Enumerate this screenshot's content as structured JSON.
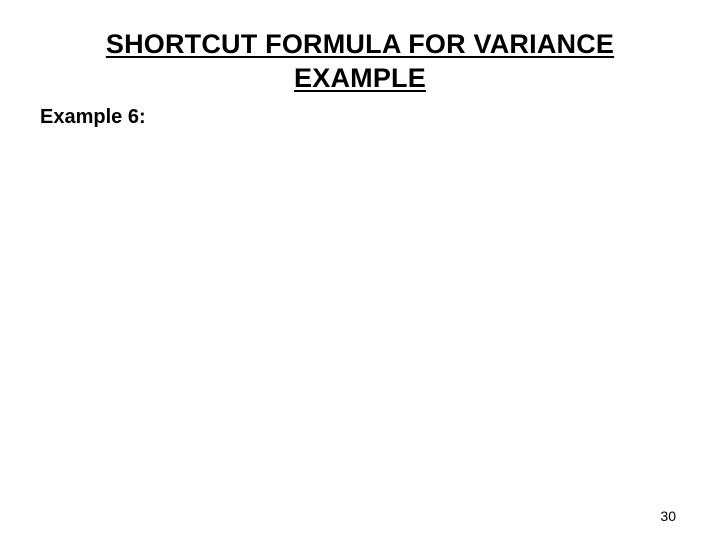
{
  "slide": {
    "title": "SHORTCUT FORMULA FOR VARIANCE\nEXAMPLE",
    "example_label": "Example 6:",
    "page_number": "30"
  }
}
